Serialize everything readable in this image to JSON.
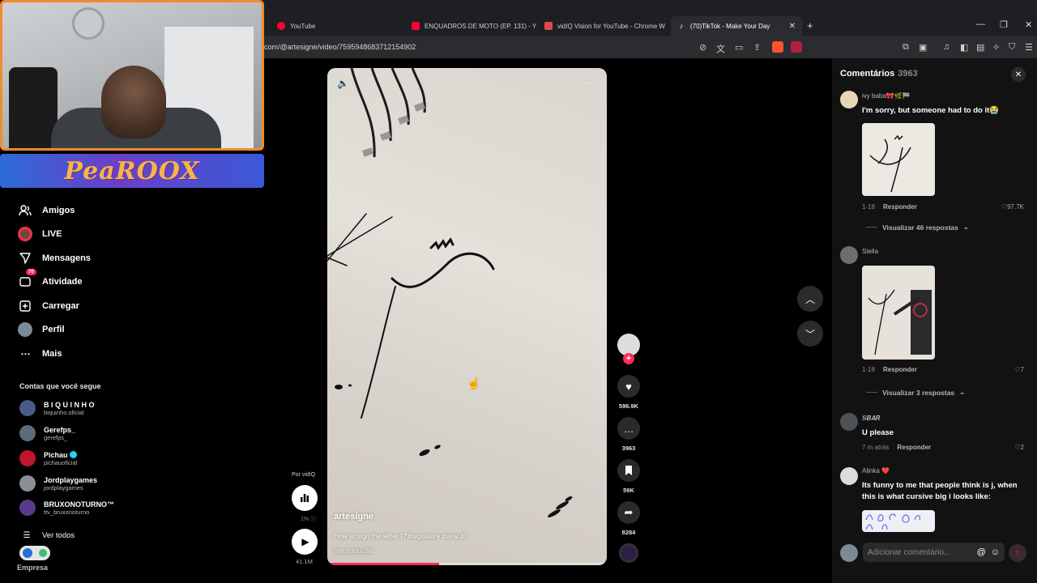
{
  "browser": {
    "tabs": [
      {
        "title": "YouTube",
        "fav_color": "#ff0033",
        "active": false
      },
      {
        "title": "ENQUADROS DE MOTO (EP. 131) - Y",
        "fav_color": "#ff0033",
        "active": false
      },
      {
        "title": "vidIQ Vision for YouTube - Chrome W",
        "fav_color": "#e14a4a",
        "active": false
      },
      {
        "title": "(70)TikTok - Make Your Day",
        "fav_color": "#ffffff",
        "active": true
      }
    ],
    "new_tab_icon": "plus-icon",
    "url": "com/@artesigne/video/7595948683712154902",
    "ext_badge_1": "7",
    "ext_badge_2": "8"
  },
  "stream_overlay": {
    "banner_text": "PeaROOX"
  },
  "sidebar": {
    "items": [
      {
        "label": "Amigos",
        "icon": "friends-icon"
      },
      {
        "label": "LIVE",
        "icon": "live-icon"
      },
      {
        "label": "Mensagens",
        "icon": "send-icon"
      },
      {
        "label": "Atividade",
        "icon": "inbox-icon",
        "badge": "70"
      },
      {
        "label": "Carregar",
        "icon": "upload-icon"
      },
      {
        "label": "Perfil",
        "icon": "profile-avatar"
      },
      {
        "label": "Mais",
        "icon": "more-icon"
      }
    ],
    "following_header": "Contas que você segue",
    "accounts": [
      {
        "name": "B I Q U I N H O",
        "handle": "biquinho.oficial",
        "color": "#4a5a8a",
        "verified": false
      },
      {
        "name": "Gerefps_",
        "handle": "gerefps_",
        "color": "#5b6c7d",
        "verified": false
      },
      {
        "name": "Pichau",
        "handle": "pichauoficial",
        "color": "#c0152a",
        "verified": true
      },
      {
        "name": "Jordplaygames",
        "handle": "jordplaygames",
        "color": "#8a8f96",
        "verified": false
      },
      {
        "name": "BRUXONOTURNO™",
        "handle": "ttv_bruxonoturno",
        "color": "#5a3a8a",
        "verified": false
      }
    ],
    "see_all": "Ver todos",
    "business": "Empresa"
  },
  "vidiq": {
    "label": "Por vidIQ",
    "percent": "1%",
    "views": "41.1M"
  },
  "video": {
    "author": "artesigne",
    "caption": "How to sign the letter I? #signature #viral #I",
    "translate": "Ver tradução",
    "progress": 0.4
  },
  "actions": {
    "likes": "596.9K",
    "comments": "3963",
    "saves": "59K",
    "shares": "8284"
  },
  "comments": {
    "title": "Comentários",
    "count": "3963",
    "items": [
      {
        "name": "ivy baba🎀🌿🏁",
        "text": "I'm sorry, but someone had to do it😭",
        "date": "1-18",
        "reply": "Responder",
        "likes": "97.7K",
        "view_replies": "Visualizar 46 respostas",
        "avatar_color": "#e8d7b5"
      },
      {
        "name": "Stella",
        "text": "",
        "date": "1-18",
        "reply": "Responder",
        "likes": "7",
        "view_replies": "Visualizar 3 respostas",
        "avatar_color": "#6b6f74"
      },
      {
        "name": "𝑺𝑩𝑨𝑹",
        "text": "U please",
        "date": "7 m atrás",
        "reply": "Responder",
        "likes": "2",
        "view_replies": "",
        "avatar_color": "#4d5256"
      },
      {
        "name": "Alinka ❤️",
        "text": "Its funny to me that people think is j, when this is what cursive big i looks like:",
        "date": "",
        "reply": "",
        "likes": "",
        "view_replies": "",
        "avatar_color": "#dcdcdc"
      }
    ],
    "add_placeholder": "Adicionar comentário..."
  }
}
